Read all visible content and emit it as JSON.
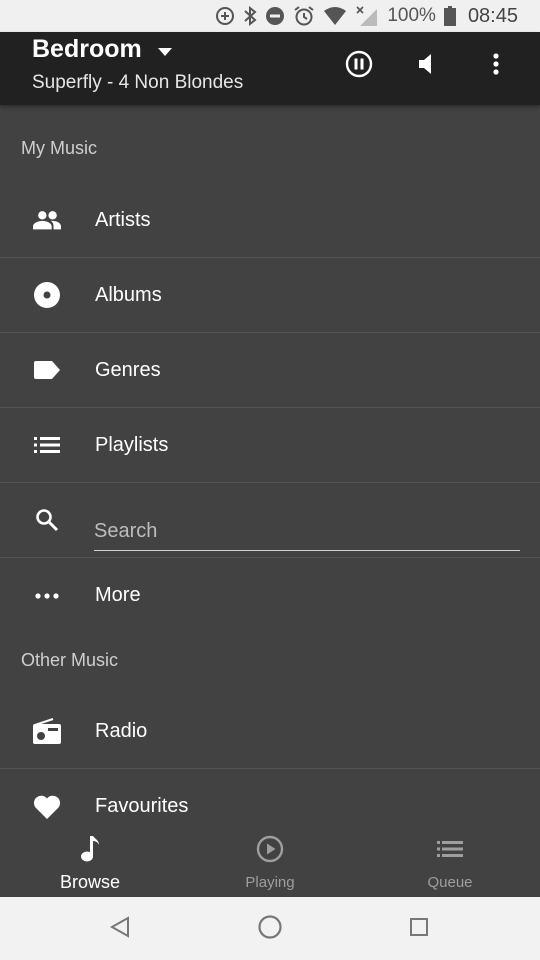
{
  "status_bar": {
    "battery": "100%",
    "time": "08:45",
    "icons": [
      "data-saver-icon",
      "bluetooth-icon",
      "do-not-disturb-icon",
      "alarm-icon",
      "wifi-icon",
      "no-signal-icon",
      "battery-icon"
    ]
  },
  "app_bar": {
    "room": "Bedroom",
    "now_playing": "Superfly - 4 Non Blondes",
    "actions": [
      "pause-icon",
      "volume-icon",
      "more-vert-icon"
    ]
  },
  "sections": [
    {
      "title": "My Music",
      "items": [
        {
          "label": "Artists",
          "icon": "people-icon"
        },
        {
          "label": "Albums",
          "icon": "album-icon"
        },
        {
          "label": "Genres",
          "icon": "label-icon"
        },
        {
          "label": "Playlists",
          "icon": "list-icon"
        }
      ],
      "search": {
        "placeholder": "Search",
        "value": ""
      },
      "more": {
        "label": "More",
        "icon": "more-horiz-icon"
      }
    },
    {
      "title": "Other Music",
      "items": [
        {
          "label": "Radio",
          "icon": "radio-icon"
        },
        {
          "label": "Favourites",
          "icon": "heart-icon"
        }
      ]
    }
  ],
  "bottom_nav": [
    {
      "label": "Browse",
      "icon": "music-note-icon",
      "active": true
    },
    {
      "label": "Playing",
      "icon": "play-circle-icon",
      "active": false
    },
    {
      "label": "Queue",
      "icon": "queue-list-icon",
      "active": false
    }
  ],
  "colors": {
    "app_bar": "#212121",
    "background": "#424242",
    "divider": "#555555",
    "text_primary": "#ffffff",
    "text_secondary": "#cfcfcf",
    "inactive": "#9e9e9e"
  }
}
